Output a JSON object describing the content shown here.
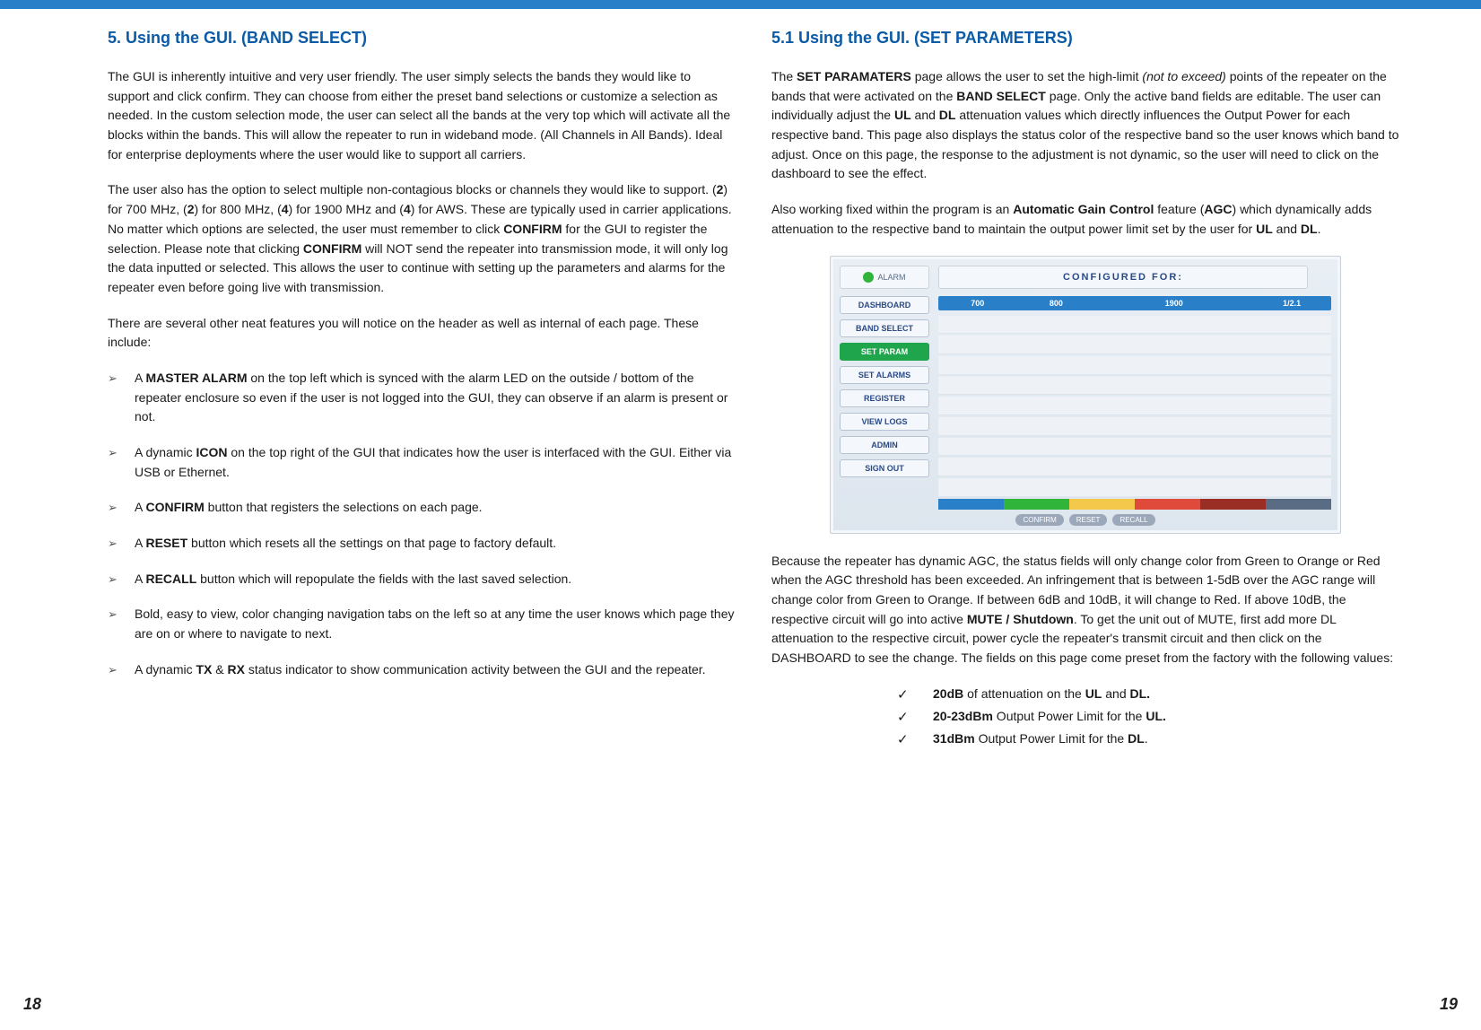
{
  "left": {
    "title": "5. Using the GUI. (BAND SELECT)",
    "p1": "The GUI is inherently intuitive and very user friendly. The user simply selects the bands they would like to support and click confirm. They can choose from either the preset band selections or customize a selection as needed. In the custom selection mode, the user can select all the bands at the very top which will activate all the blocks within the bands. This will allow the repeater to run in wideband mode. (All Channels in All Bands). Ideal for enterprise deployments where the user would like to support all carriers.",
    "p2_a": "The user also has the option to select multiple non-contagious blocks or channels they would like to support. (",
    "p2_b1": "2",
    "p2_c": ") for 700 MHz, (",
    "p2_b2": "2",
    "p2_d": ") for 800 MHz, (",
    "p2_b3": "4",
    "p2_e": ") for 1900 MHz and (",
    "p2_b4": "4",
    "p2_f": ") for AWS. These are typically used in carrier applications. No matter which options are selected, the user must remember to click ",
    "p2_conf1": "CONFIRM",
    "p2_g": " for the GUI to register the selection. Please note that clicking ",
    "p2_conf2": "CONFIRM",
    "p2_h": " will NOT send the repeater into transmission mode, it will only log the data inputted or selected. This allows the user to continue with setting up the parameters and alarms for the repeater even before going live with transmission.",
    "p3": "There are several other neat features you will notice on the header as well as internal of each page. These include:",
    "bullets": [
      {
        "pre": "A ",
        "b": "MASTER ALARM",
        "post": " on the top left which is synced with the alarm LED on the outside / bottom of the repeater enclosure so even if the user is not logged into the GUI, they can observe if an alarm is present or not."
      },
      {
        "pre": "A dynamic ",
        "b": "ICON",
        "post": " on the top right of the GUI that indicates how the user is interfaced with the GUI. Either via USB or Ethernet."
      },
      {
        "pre": "A ",
        "b": "CONFIRM",
        "post": " button that registers the selections on each page."
      },
      {
        "pre": "A ",
        "b": "RESET",
        "post": " button which resets all the settings on that page to factory default."
      },
      {
        "pre": "A ",
        "b": "RECALL",
        "post": " button which will repopulate the fields with the last saved selection."
      },
      {
        "pre": "",
        "b": "",
        "post": "Bold, easy to view, color changing navigation tabs on the left so at any time the user knows which page they are on or where to navigate to next."
      },
      {
        "pre": "A dynamic ",
        "b": "TX",
        "mid": " & ",
        "b2": "RX",
        "post": " status indicator to show communication activity between the GUI and the repeater."
      }
    ],
    "pagenum": "18"
  },
  "right": {
    "title": "5.1 Using the GUI. (SET PARAMETERS)",
    "p1_a": "The ",
    "p1_b1": "SET PARAMATERS",
    "p1_b": " page allows the user to set the high-limit ",
    "p1_it": "(not to exceed)",
    "p1_c": " points of the repeater on the bands that were activated on the ",
    "p1_b2": "BAND SELECT",
    "p1_d": " page. Only the active band fields are editable. The user can individually adjust the ",
    "p1_ul": "UL",
    "p1_e": " and ",
    "p1_dl": "DL",
    "p1_f": " attenuation values which directly influences the Output Power for each respective band. This page also displays the status color of the respective band so the user knows which band to adjust. Once on this page, the response to the adjustment is not dynamic, so the user will need to click on the dashboard to see the effect.",
    "p2_a": "Also working fixed within the program is an ",
    "p2_b1": "Automatic Gain Control",
    "p2_b": " feature (",
    "p2_b2": "AGC",
    "p2_c": ") which dynamically adds attenuation to the respective band to maintain the output power limit set by the user for ",
    "p2_ul": "UL",
    "p2_d": " and ",
    "p2_dl": "DL",
    "p2_e": ".",
    "ss": {
      "header": "CONFIGURED FOR:",
      "alarm": "ALARM",
      "nav": [
        "DASHBOARD",
        "BAND SELECT",
        "SET PARAM",
        "SET ALARMS",
        "REGISTER",
        "VIEW LOGS",
        "ADMIN",
        "SIGN OUT"
      ],
      "bands": [
        "700",
        "800",
        "1900",
        "1/2.1"
      ],
      "buttons": [
        "CONFIRM",
        "RESET",
        "RECALL"
      ],
      "status_colors": [
        "#2a7fc9",
        "#31b43a",
        "#f4c84a",
        "#e04a3a",
        "#9a2e25",
        "#5a6c84"
      ]
    },
    "p3_a": "Because the repeater has dynamic AGC, the status fields will only change color from Green to Orange or Red when the AGC threshold has been exceeded. An infringement that is between 1-5dB over the AGC range will change color from Green to Orange. If between 6dB and 10dB, it will change to Red. If above 10dB, the respective circuit will go into active ",
    "p3_b1": "MUTE / Shutdown",
    "p3_b": ". To get the unit out of MUTE, first add more DL attenuation to the respective circuit, power cycle the repeater's transmit circuit and then click on the DASHBOARD to see the change. The fields on this page come preset from the factory with the following values:",
    "checks": [
      {
        "b1": "20dB",
        "m": " of attenuation on the ",
        "b2": "UL",
        "m2": " and ",
        "b3": "DL."
      },
      {
        "b1": "20-23dBm",
        "m": " Output Power Limit for the ",
        "b2": "UL."
      },
      {
        "b1": "31dBm",
        "m": " Output Power Limit for the ",
        "b2": "DL",
        "m2": "."
      }
    ],
    "pagenum": "19"
  }
}
